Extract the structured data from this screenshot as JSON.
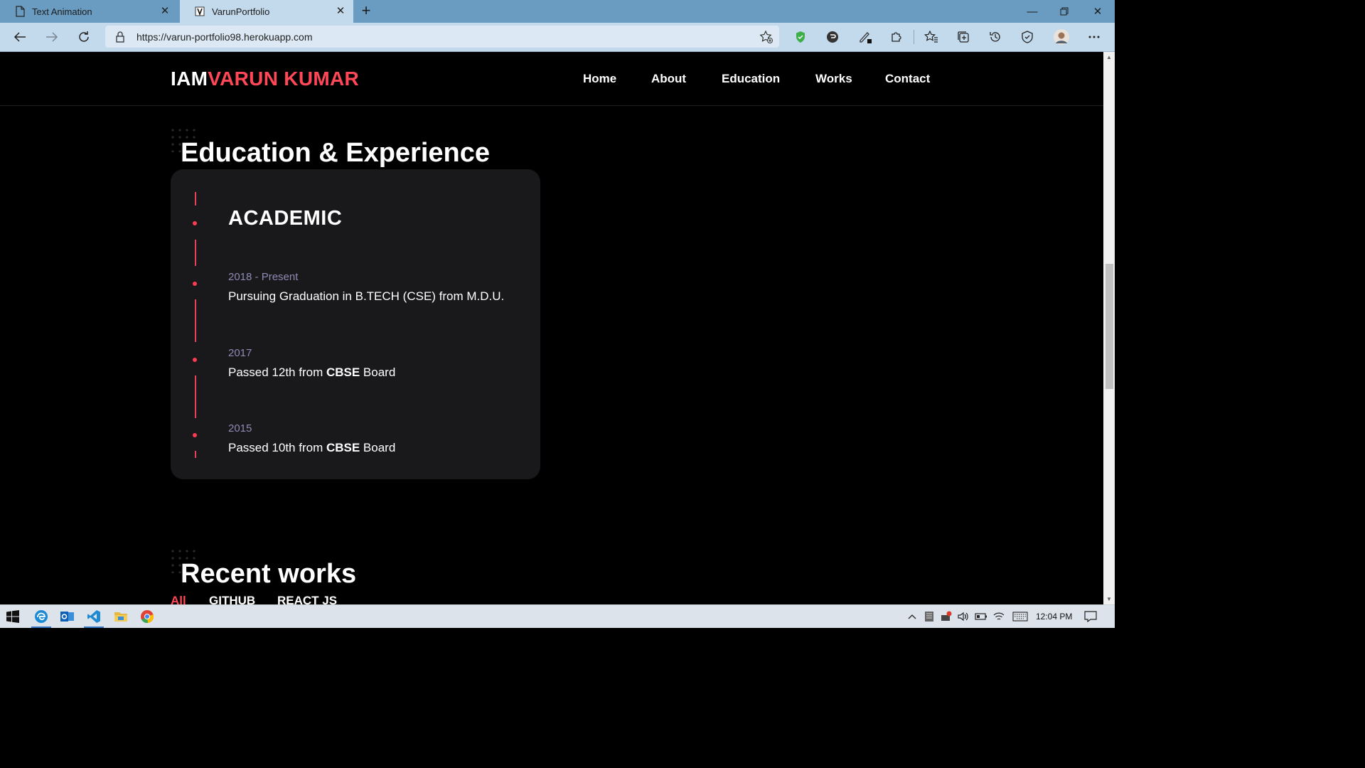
{
  "browser": {
    "tabs": [
      {
        "title": "Text Animation",
        "active": false
      },
      {
        "title": "VarunPortfolio",
        "active": true
      }
    ],
    "url": "https://varun-portfolio98.herokuapp.com",
    "icons": [
      "back-icon",
      "forward-icon",
      "refresh-icon",
      "lock-icon",
      "add-favorite-icon",
      "shield-extension-icon",
      "extension-icon",
      "pen-extension-icon",
      "puzzle-icon",
      "favorites-icon",
      "collections-icon",
      "history-icon",
      "performance-icon",
      "profile-avatar",
      "more-icon"
    ]
  },
  "site": {
    "logo_prefix": "IAM",
    "logo_name": "VARUN KUMAR",
    "nav": [
      "Home",
      "About",
      "Education",
      "Works",
      "Contact"
    ],
    "education_title": "Education & Experience",
    "card_heading": "ACADEMIC",
    "items": [
      {
        "year": "2018 - Present",
        "desc": "Pursuing Graduation in B.TECH (CSE) from M.D.U."
      },
      {
        "year": "2017",
        "desc_pre": "Passed 12th from ",
        "desc_bold": "CBSE",
        "desc_post": " Board"
      },
      {
        "year": "2015",
        "desc_pre": "Passed 10th from ",
        "desc_bold": "CBSE",
        "desc_post": " Board"
      }
    ],
    "works_title": "Recent works",
    "filters": [
      "All",
      "GITHUB",
      "REACT JS"
    ],
    "active_filter": "All"
  },
  "taskbar": {
    "apps": [
      "windows-start-icon",
      "edge-icon",
      "outlook-icon",
      "vscode-icon",
      "file-explorer-icon",
      "chrome-icon"
    ],
    "clock": "12:04 PM"
  },
  "colors": {
    "accent": "#ff4757",
    "card_bg": "#19191c",
    "year": "#8e8ab4"
  }
}
